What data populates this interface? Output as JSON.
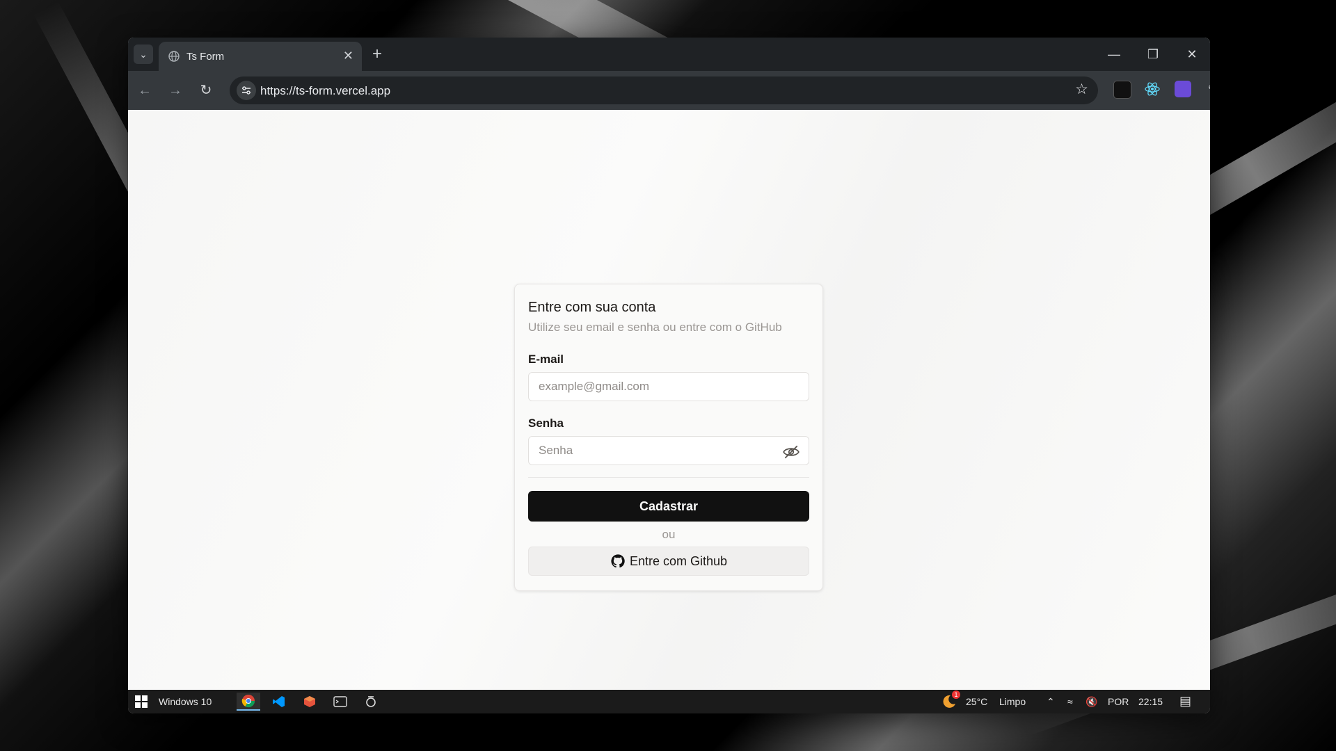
{
  "browser": {
    "tab_title": "Ts Form",
    "url": "https://ts-form.vercel.app"
  },
  "card": {
    "title": "Entre com sua conta",
    "subtitle": "Utilize seu email e senha ou entre com o GitHub",
    "email_label": "E-mail",
    "email_placeholder": "example@gmail.com",
    "password_label": "Senha",
    "password_placeholder": "Senha",
    "submit_label": "Cadastrar",
    "or_text": "ou",
    "github_label": "Entre com Github"
  },
  "taskbar": {
    "os_label": "Windows 10",
    "weather": "25°C",
    "weather_desc": "Limpo",
    "language": "POR",
    "time": "22:15",
    "weather_badge": "1"
  },
  "colors": {
    "primary_button": "#111111",
    "background": "#fafaf9",
    "browser_frame": "#35393d"
  }
}
